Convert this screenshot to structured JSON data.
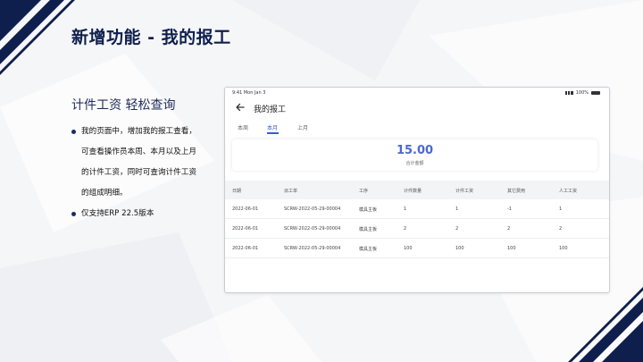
{
  "slide": {
    "title": "新增功能 - 我的报工",
    "subtitle": "计件工资  轻松查询",
    "bullets": [
      {
        "lines": [
          "我的页面中，增加我的报工查看，",
          "可查看操作员本周、本月以及上月",
          "的计件工资，同时可查询计件工资",
          "的组成明细。"
        ]
      },
      {
        "lines": [
          "仅支持ERP 22.5版本"
        ]
      }
    ]
  },
  "device": {
    "status_time": "9:41  Mon Jan 3",
    "status_battery": "100%",
    "page_title": "我的报工",
    "tabs": [
      {
        "label": "本周",
        "active": false
      },
      {
        "label": "本月",
        "active": true
      },
      {
        "label": "上月",
        "active": false
      }
    ],
    "summary": {
      "amount": "15.00",
      "label": "合计金额"
    },
    "table": {
      "headers": [
        "日期",
        "派工单",
        "工序",
        "计件数量",
        "计件工资",
        "其它费用",
        "人工工资"
      ],
      "rows": [
        [
          "2022-06-01",
          "SCRW-2022-05-29-00004",
          "模具主板",
          "1",
          "1",
          "-1",
          "1"
        ],
        [
          "2022-06-01",
          "SCRW-2022-05-29-00004",
          "模具主板",
          "2",
          "2",
          "2",
          "2"
        ],
        [
          "2022-06-01",
          "SCRW-2022-05-29-00004",
          "模具主板",
          "100",
          "100",
          "100",
          "100"
        ]
      ]
    }
  },
  "colors": {
    "navy": "#0f1f4d",
    "accent": "#3a5ccc"
  }
}
